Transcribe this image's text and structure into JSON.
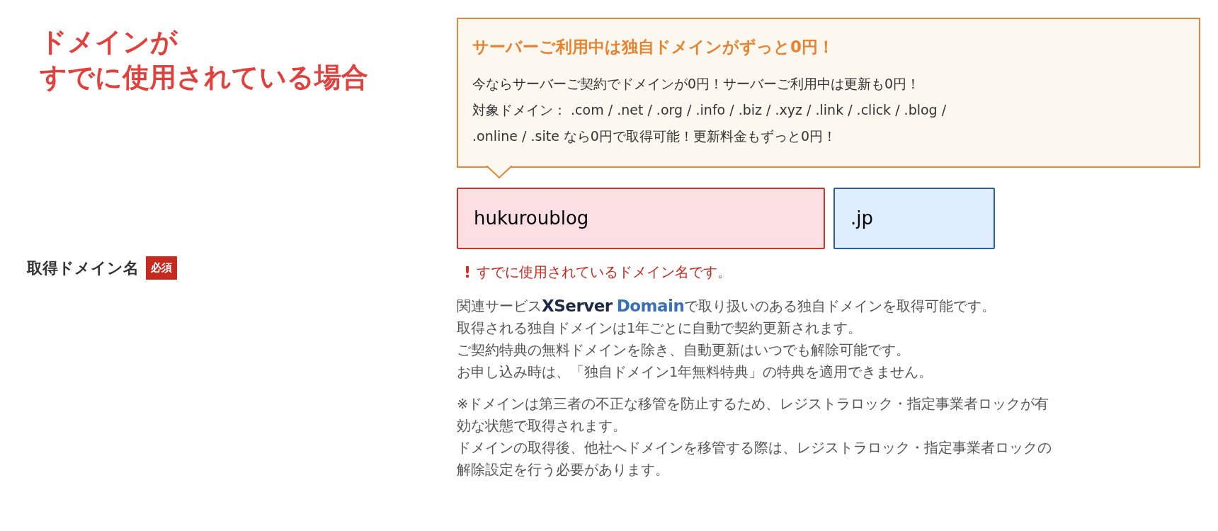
{
  "annotation": {
    "lines": [
      "ドメインが",
      "すでに使用されている場合"
    ]
  },
  "callout": {
    "title": "サーバーご利用中は独自ドメインがずっと0円！",
    "lines": [
      "今ならサーバーご契約でドメインが0円！サーバーご利用中は更新も0円！",
      "対象ドメイン： .com / .net / .org / .info / .biz / .xyz / .link / .click / .blog /",
      ".online / .site なら0円で取得可能！更新料金もずっと0円！"
    ]
  },
  "field_label": {
    "text": "取得ドメイン名",
    "badge": "必須"
  },
  "fields": [
    {
      "value": "hukuroublog",
      "invalid": true
    },
    {
      "value": ".jp",
      "invalid": false
    }
  ],
  "error": {
    "icon": "!",
    "text": "すでに使用されているドメイン名です。"
  },
  "notes": {
    "intro": {
      "before": "関連サービス",
      "logo_primary": "XServer",
      "logo_secondary": "Domain",
      "after": "で取り扱いのある独自ドメインを取得可能です。"
    },
    "lines": [
      "取得される独自ドメインは1年ごとに自動で契約更新されます。",
      "ご契約特典の無料ドメインを除き、自動更新はいつでも解除可能です。",
      "お申し込み時は、「独自ドメイン1年無料特典」の特典を適用できません。"
    ],
    "caution_lines": [
      "※ドメインは第三者の不正な移管を防止するため、レジストラロック・指定事業者ロックが有",
      "効な状態で取得されます。",
      "ドメインの取得後、他社へドメインを移管する際は、レジストラロック・指定事業者ロックの",
      "解除設定を行う必要があります。"
    ]
  }
}
